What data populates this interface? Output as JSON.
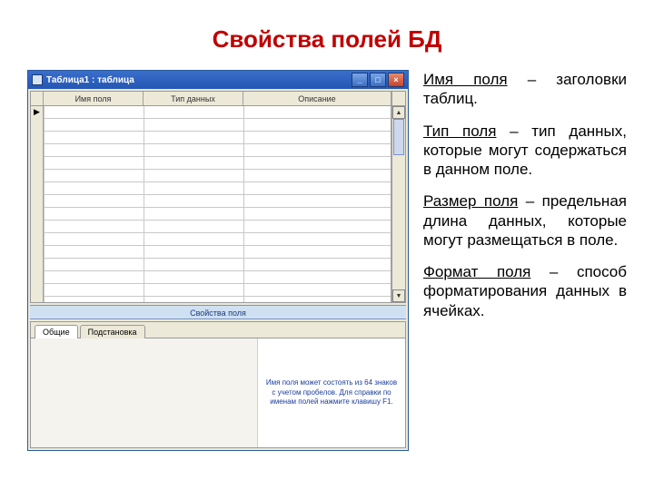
{
  "title": "Свойства полей БД",
  "window": {
    "title": "Таблица1 : таблица",
    "controls": {
      "min": "_",
      "max": "□",
      "close": "×"
    },
    "columns": {
      "sel": "",
      "c1": "Имя поля",
      "c2": "Тип данных",
      "c3": "Описание"
    },
    "row_marker": "▶",
    "section_label": "Свойства поля",
    "tabs": {
      "general": "Общие",
      "lookup": "Подстановка"
    },
    "hint": "Имя поля может состоять из 64 знаков с учетом пробелов. Для справки по именам полей нажмите клавишу F1."
  },
  "explain": {
    "p1_term": "Имя поля",
    "p1_rest": " – заголовки таблиц.",
    "p2_term": "Тип поля",
    "p2_rest": " – тип данных, которые могут содержаться в данном поле.",
    "p3_term": "Размер поля",
    "p3_rest": " – предельная длина данных, которые могут размещаться в поле.",
    "p4_term": "Формат поля",
    "p4_rest": " – способ форматирования данных в ячейках."
  }
}
